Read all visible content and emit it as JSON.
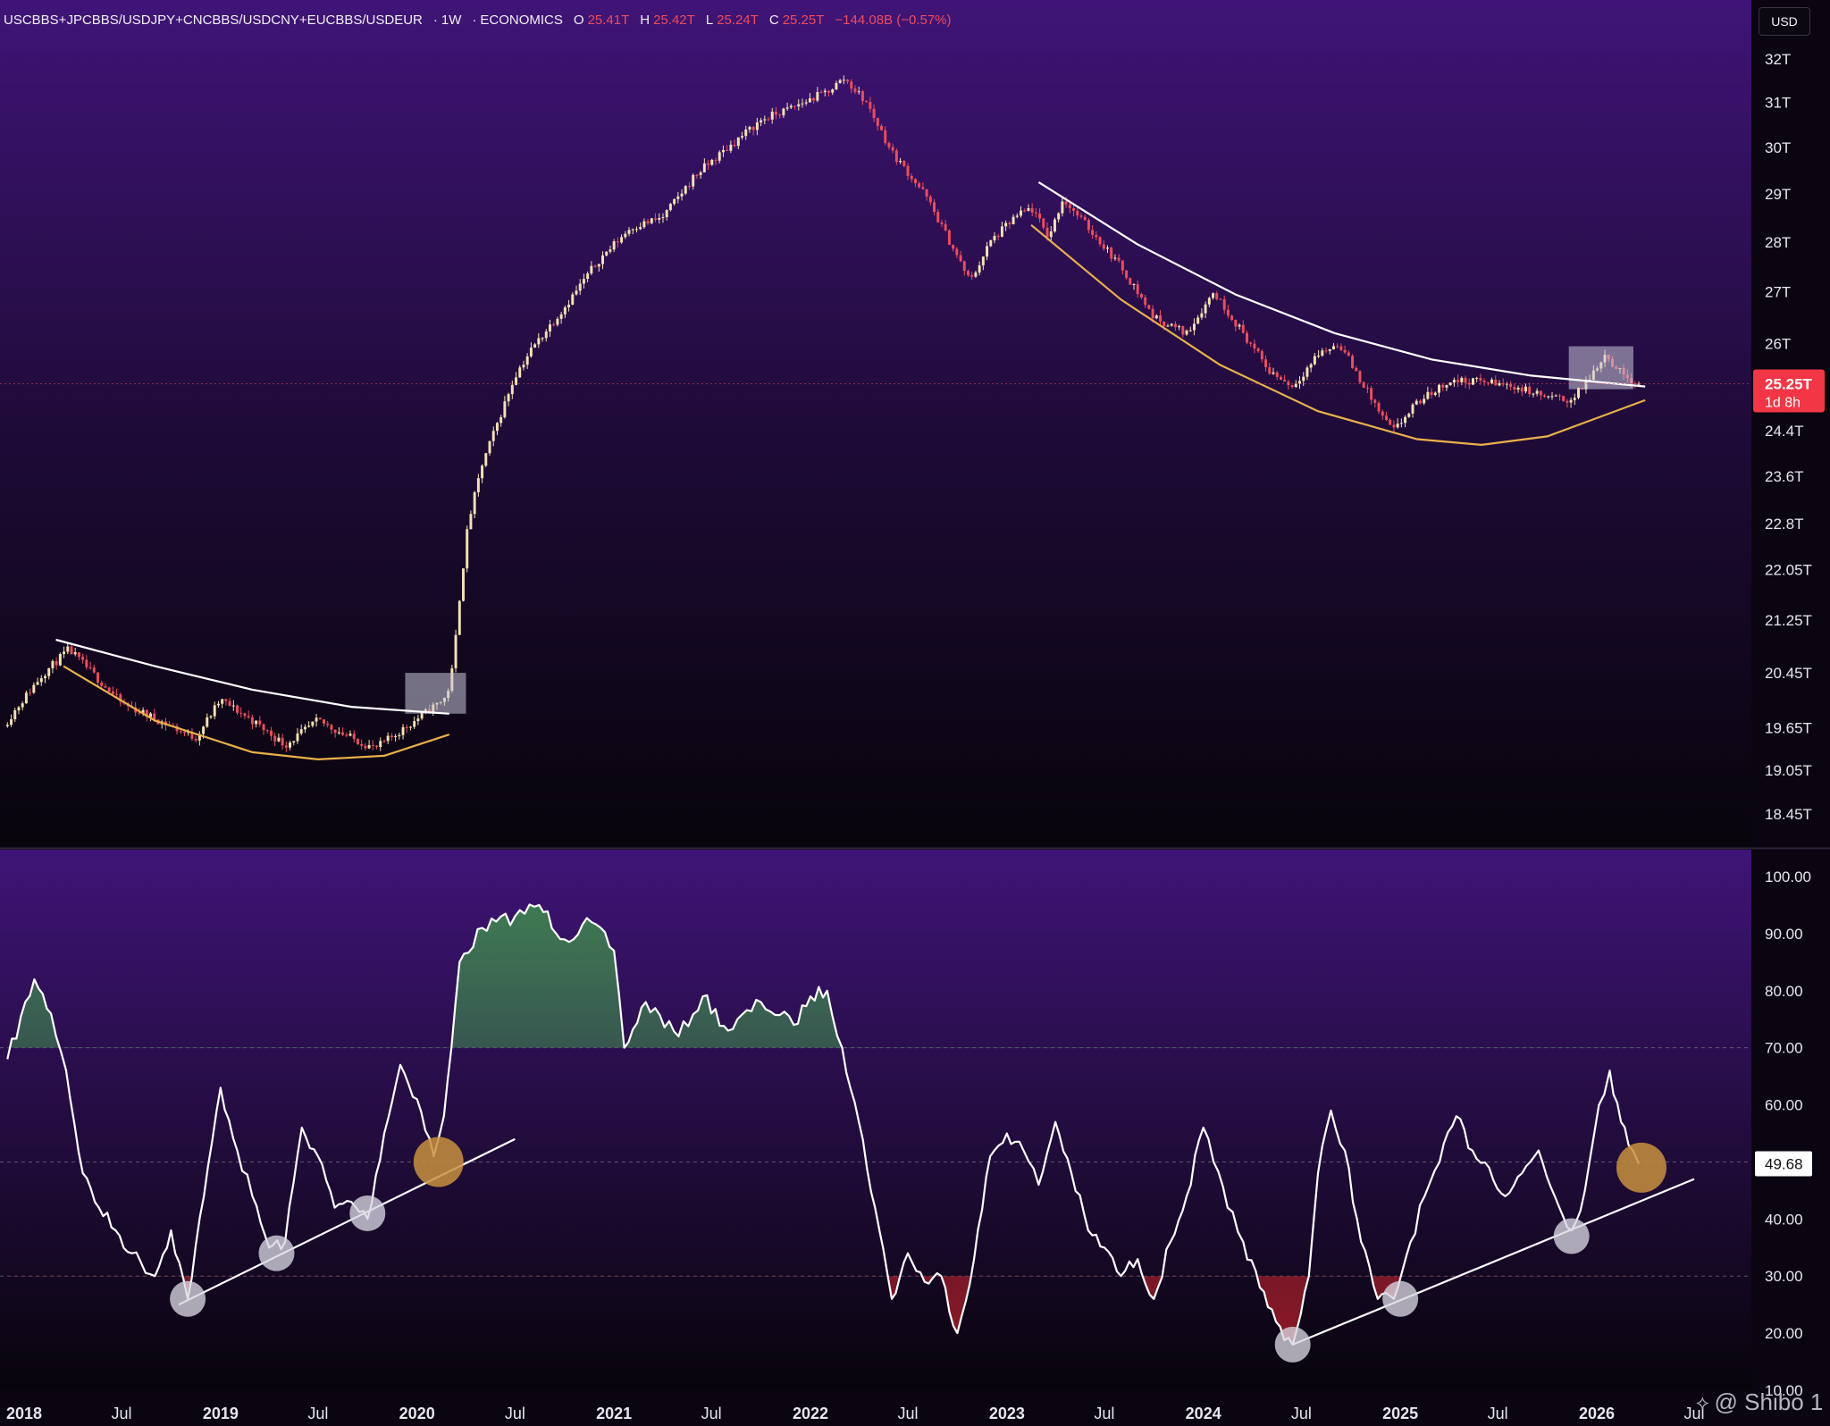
{
  "header": {
    "symbol": "USCBBS+JPCBBS/USDJPY+CNCBBS/USDCNY+EUCBBS/USDEUR",
    "interval": "1W",
    "source": "ECONOMICS",
    "open_label": "O",
    "open": "25.41T",
    "high_label": "H",
    "high": "25.42T",
    "low_label": "L",
    "low": "25.24T",
    "close_label": "C",
    "close": "25.25T",
    "change": "−144.08B (−0.57%)"
  },
  "currency": "USD",
  "watermark": "@ Shibo 1",
  "colors": {
    "up": "#f4e3b0",
    "down": "#ef4c5b",
    "gold_curve": "#e9b14a",
    "white_line": "#ffffff",
    "bg_top": "#3f1477",
    "bg_bottom": "#0a0510",
    "rsi_line": "#ffffff",
    "price_tag": "#f23645"
  },
  "chart_data": [
    {
      "type": "candlestick",
      "name": "price",
      "y_scale": "log",
      "ylim": [
        18.0,
        32.5
      ],
      "y_ticks": [
        "32T",
        "31T",
        "30T",
        "29T",
        "28T",
        "27T",
        "26T",
        "25.25T",
        "24.4T",
        "23.6T",
        "22.8T",
        "22.05T",
        "21.25T",
        "20.45T",
        "19.65T",
        "19.05T",
        "18.45T"
      ],
      "y_tick_values": [
        32,
        31,
        30,
        29,
        28,
        27,
        26,
        25.25,
        24.4,
        23.6,
        22.8,
        22.05,
        21.25,
        20.45,
        19.65,
        19.05,
        18.45
      ],
      "current_value_label": "25.25T",
      "countdown": "1d 8h",
      "path": [
        [
          "2017-12-01",
          19.75
        ],
        [
          "2018-02-01",
          20.4
        ],
        [
          "2018-03-25",
          20.8
        ],
        [
          "2018-05-01",
          20.5
        ],
        [
          "2018-07-01",
          20.0
        ],
        [
          "2018-09-01",
          19.78
        ],
        [
          "2018-11-15",
          19.5
        ],
        [
          "2019-01-01",
          20.05
        ],
        [
          "2019-03-01",
          19.75
        ],
        [
          "2019-05-01",
          19.4
        ],
        [
          "2019-07-01",
          19.75
        ],
        [
          "2019-09-01",
          19.5
        ],
        [
          "2019-10-15",
          19.35
        ],
        [
          "2019-12-01",
          19.6
        ],
        [
          "2020-01-15",
          19.85
        ],
        [
          "2020-02-25",
          20.1
        ],
        [
          "2020-03-08",
          20.55
        ],
        [
          "2020-03-20",
          21.6
        ],
        [
          "2020-04-05",
          22.8
        ],
        [
          "2020-05-01",
          23.8
        ],
        [
          "2020-06-01",
          24.6
        ],
        [
          "2020-07-01",
          25.4
        ],
        [
          "2020-08-01",
          25.9
        ],
        [
          "2020-10-01",
          26.7
        ],
        [
          "2020-12-01",
          27.6
        ],
        [
          "2021-02-01",
          28.3
        ],
        [
          "2021-04-01",
          28.5
        ],
        [
          "2021-06-01",
          29.4
        ],
        [
          "2021-08-01",
          30.0
        ],
        [
          "2021-10-01",
          30.6
        ],
        [
          "2021-12-01",
          30.9
        ],
        [
          "2022-02-01",
          31.25
        ],
        [
          "2022-03-05",
          31.55
        ],
        [
          "2022-04-15",
          31.0
        ],
        [
          "2022-06-01",
          29.9
        ],
        [
          "2022-08-01",
          29.0
        ],
        [
          "2022-10-01",
          27.7
        ],
        [
          "2022-10-25",
          27.2
        ],
        [
          "2022-12-01",
          28.0
        ],
        [
          "2023-01-15",
          28.5
        ],
        [
          "2023-02-15",
          28.7
        ],
        [
          "2023-03-20",
          28.1
        ],
        [
          "2023-04-15",
          28.9
        ],
        [
          "2023-06-01",
          28.3
        ],
        [
          "2023-08-01",
          27.5
        ],
        [
          "2023-10-01",
          26.5
        ],
        [
          "2023-12-01",
          26.2
        ],
        [
          "2024-01-20",
          27.0
        ],
        [
          "2024-03-01",
          26.4
        ],
        [
          "2024-05-01",
          25.5
        ],
        [
          "2024-06-15",
          25.2
        ],
        [
          "2024-08-01",
          25.8
        ],
        [
          "2024-09-10",
          26.0
        ],
        [
          "2024-10-20",
          25.3
        ],
        [
          "2024-12-01",
          24.6
        ],
        [
          "2024-12-20",
          24.4
        ],
        [
          "2025-02-01",
          24.9
        ],
        [
          "2025-04-01",
          25.3
        ],
        [
          "2025-06-01",
          25.3
        ],
        [
          "2025-08-01",
          25.2
        ],
        [
          "2025-10-01",
          25.0
        ],
        [
          "2025-11-15",
          24.95
        ],
        [
          "2025-12-15",
          25.3
        ],
        [
          "2026-01-15",
          25.8
        ],
        [
          "2026-02-15",
          25.45
        ],
        [
          "2026-03-20",
          25.25
        ]
      ],
      "overlays": {
        "upper_lines": [
          [
            [
              "2018-03-01",
              20.95
            ],
            [
              "2018-09-01",
              20.55
            ],
            [
              "2019-03-01",
              20.2
            ],
            [
              "2019-09-01",
              19.95
            ],
            [
              "2020-03-01",
              19.85
            ]
          ],
          [
            [
              "2023-03-01",
              29.25
            ],
            [
              "2023-09-01",
              27.95
            ],
            [
              "2024-03-01",
              26.95
            ],
            [
              "2024-09-01",
              26.2
            ],
            [
              "2025-03-01",
              25.7
            ],
            [
              "2025-09-01",
              25.4
            ],
            [
              "2026-04-01",
              25.2
            ]
          ]
        ],
        "lower_curves": [
          [
            [
              "2018-03-15",
              20.55
            ],
            [
              "2018-09-01",
              19.75
            ],
            [
              "2019-03-01",
              19.3
            ],
            [
              "2019-07-01",
              19.2
            ],
            [
              "2019-11-01",
              19.25
            ],
            [
              "2020-03-01",
              19.55
            ]
          ],
          [
            [
              "2023-02-15",
              28.35
            ],
            [
              "2023-08-01",
              26.85
            ],
            [
              "2024-02-01",
              25.6
            ],
            [
              "2024-08-01",
              24.75
            ],
            [
              "2025-02-01",
              24.25
            ],
            [
              "2025-06-01",
              24.15
            ],
            [
              "2025-10-01",
              24.3
            ],
            [
              "2026-04-01",
              24.95
            ]
          ]
        ],
        "highlight_boxes": [
          {
            "x": [
              "2019-12-10",
              "2020-04-01"
            ],
            "y": [
              19.85,
              20.45
            ]
          },
          {
            "x": [
              "2025-11-10",
              "2026-03-10"
            ],
            "y": [
              25.15,
              25.95
            ]
          }
        ]
      }
    },
    {
      "type": "line",
      "name": "rsi",
      "ylim": [
        10,
        100
      ],
      "y_ticks": [
        "100.00",
        "90.00",
        "80.00",
        "70.00",
        "60.00",
        "50.00",
        "40.00",
        "30.00",
        "20.00",
        "10.00"
      ],
      "y_tick_values": [
        100,
        90,
        80,
        70,
        60,
        50,
        40,
        30,
        20,
        10
      ],
      "reference_lines": [
        70,
        50,
        30
      ],
      "current_value_label": "49.68",
      "path": [
        [
          "2017-12-01",
          68
        ],
        [
          "2018-01-20",
          82
        ],
        [
          "2018-02-20",
          76
        ],
        [
          "2018-03-20",
          66
        ],
        [
          "2018-04-20",
          48
        ],
        [
          "2018-05-20",
          42
        ],
        [
          "2018-06-20",
          38
        ],
        [
          "2018-07-20",
          34
        ],
        [
          "2018-09-01",
          30
        ],
        [
          "2018-10-01",
          38
        ],
        [
          "2018-11-01",
          26
        ],
        [
          "2018-12-01",
          44
        ],
        [
          "2019-01-01",
          63
        ],
        [
          "2019-02-01",
          52
        ],
        [
          "2019-03-01",
          44
        ],
        [
          "2019-04-01",
          35
        ],
        [
          "2019-05-01",
          36
        ],
        [
          "2019-06-01",
          56
        ],
        [
          "2019-07-01",
          51
        ],
        [
          "2019-08-01",
          42
        ],
        [
          "2019-09-01",
          43
        ],
        [
          "2019-10-01",
          40
        ],
        [
          "2019-11-01",
          55
        ],
        [
          "2019-12-01",
          67
        ],
        [
          "2020-01-01",
          61
        ],
        [
          "2020-02-01",
          51
        ],
        [
          "2020-02-20",
          58
        ],
        [
          "2020-03-05",
          70
        ],
        [
          "2020-03-20",
          85
        ],
        [
          "2020-05-01",
          91
        ],
        [
          "2020-07-01",
          93
        ],
        [
          "2020-08-15",
          95
        ],
        [
          "2020-10-01",
          89
        ],
        [
          "2020-11-20",
          92
        ],
        [
          "2021-01-01",
          87
        ],
        [
          "2021-01-20",
          70
        ],
        [
          "2021-03-01",
          78
        ],
        [
          "2021-05-01",
          72
        ],
        [
          "2021-06-15",
          79
        ],
        [
          "2021-08-01",
          73
        ],
        [
          "2021-10-01",
          78
        ],
        [
          "2021-12-01",
          74
        ],
        [
          "2022-01-01",
          79
        ],
        [
          "2022-02-01",
          80
        ],
        [
          "2022-03-01",
          70
        ],
        [
          "2022-04-01",
          57
        ],
        [
          "2022-05-01",
          42
        ],
        [
          "2022-06-01",
          26
        ],
        [
          "2022-07-01",
          34
        ],
        [
          "2022-08-01",
          29
        ],
        [
          "2022-09-01",
          30
        ],
        [
          "2022-10-01",
          20
        ],
        [
          "2022-11-01",
          33
        ],
        [
          "2022-12-01",
          51
        ],
        [
          "2023-01-01",
          55
        ],
        [
          "2023-02-01",
          52
        ],
        [
          "2023-03-01",
          46
        ],
        [
          "2023-04-01",
          57
        ],
        [
          "2023-05-01",
          48
        ],
        [
          "2023-06-01",
          38
        ],
        [
          "2023-07-01",
          35
        ],
        [
          "2023-08-01",
          30
        ],
        [
          "2023-09-01",
          33
        ],
        [
          "2023-10-01",
          26
        ],
        [
          "2023-11-01",
          36
        ],
        [
          "2023-12-01",
          44
        ],
        [
          "2024-01-01",
          56
        ],
        [
          "2024-01-20",
          50
        ],
        [
          "2024-02-15",
          42
        ],
        [
          "2024-03-15",
          36
        ],
        [
          "2024-04-15",
          28
        ],
        [
          "2024-05-15",
          22
        ],
        [
          "2024-06-15",
          18
        ],
        [
          "2024-07-15",
          30
        ],
        [
          "2024-08-01",
          48
        ],
        [
          "2024-08-25",
          59
        ],
        [
          "2024-09-20",
          52
        ],
        [
          "2024-10-20",
          36
        ],
        [
          "2024-11-20",
          26
        ],
        [
          "2024-12-20",
          26
        ],
        [
          "2025-01-20",
          36
        ],
        [
          "2025-02-15",
          44
        ],
        [
          "2025-03-15",
          50
        ],
        [
          "2025-04-15",
          58
        ],
        [
          "2025-05-15",
          52
        ],
        [
          "2025-06-15",
          49
        ],
        [
          "2025-07-15",
          44
        ],
        [
          "2025-08-15",
          48
        ],
        [
          "2025-09-15",
          52
        ],
        [
          "2025-10-15",
          44
        ],
        [
          "2025-11-15",
          38
        ],
        [
          "2025-12-10",
          45
        ],
        [
          "2026-01-05",
          60
        ],
        [
          "2026-01-25",
          66
        ],
        [
          "2026-02-15",
          57
        ],
        [
          "2026-03-01",
          53
        ],
        [
          "2026-03-20",
          49.68
        ]
      ],
      "overlays": {
        "trendlines": [
          [
            [
              "2018-10-15",
              25
            ],
            [
              "2020-07-01",
              54
            ]
          ],
          [
            [
              "2024-06-15",
              18
            ],
            [
              "2026-07-01",
              47
            ]
          ]
        ],
        "markers_white": [
          [
            "2018-11-01",
            26
          ],
          [
            "2019-04-15",
            34
          ],
          [
            "2019-10-01",
            41
          ],
          [
            "2024-06-15",
            18
          ],
          [
            "2025-01-01",
            26
          ],
          [
            "2025-11-15",
            37
          ]
        ],
        "markers_gold": [
          [
            "2020-02-10",
            50
          ],
          [
            "2026-03-25",
            49
          ]
        ]
      }
    }
  ],
  "x_axis": {
    "ticks": [
      {
        "label": "2018",
        "date": "2018-01-01"
      },
      {
        "label": "Jul",
        "date": "2018-07-01"
      },
      {
        "label": "2019",
        "date": "2019-01-01"
      },
      {
        "label": "Jul",
        "date": "2019-07-01"
      },
      {
        "label": "2020",
        "date": "2020-01-01"
      },
      {
        "label": "Jul",
        "date": "2020-07-01"
      },
      {
        "label": "2021",
        "date": "2021-01-01"
      },
      {
        "label": "Jul",
        "date": "2021-07-01"
      },
      {
        "label": "2022",
        "date": "2022-01-01"
      },
      {
        "label": "Jul",
        "date": "2022-07-01"
      },
      {
        "label": "2023",
        "date": "2023-01-01"
      },
      {
        "label": "Jul",
        "date": "2023-07-01"
      },
      {
        "label": "2024",
        "date": "2024-01-01"
      },
      {
        "label": "Jul",
        "date": "2024-07-01"
      },
      {
        "label": "2025",
        "date": "2025-01-01"
      },
      {
        "label": "Jul",
        "date": "2025-07-01"
      },
      {
        "label": "2026",
        "date": "2026-01-01"
      },
      {
        "label": "Jul",
        "date": "2026-07-01"
      }
    ]
  }
}
